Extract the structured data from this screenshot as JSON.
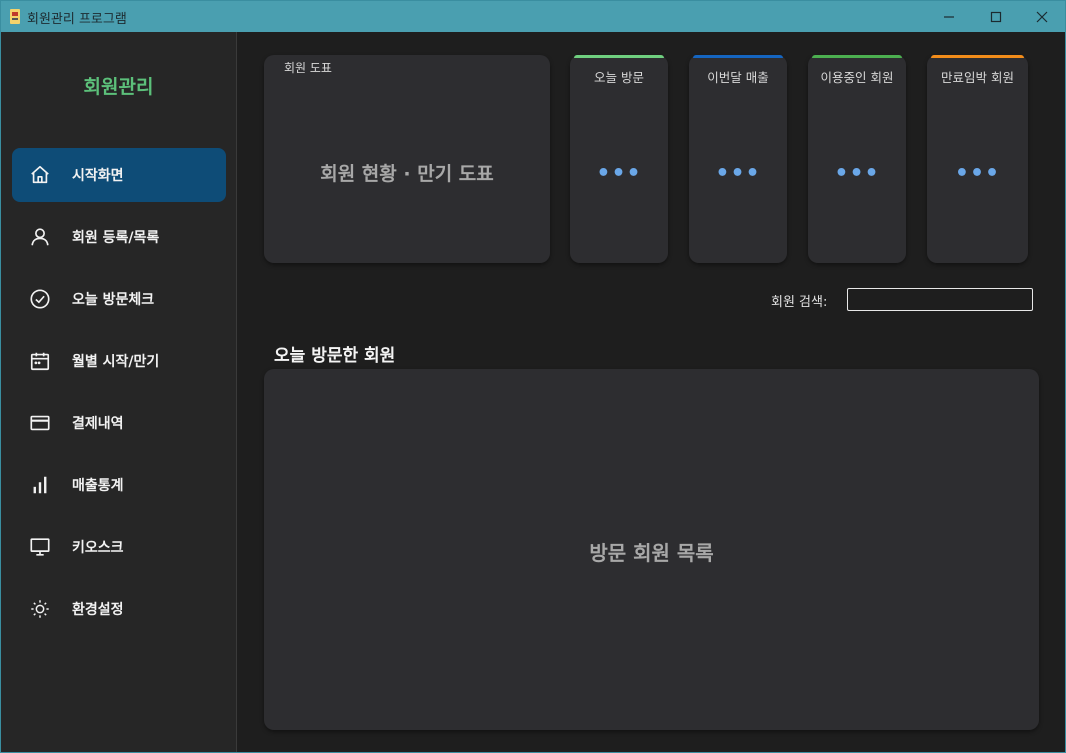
{
  "window": {
    "title": "회원관리 프로그램",
    "controls": {
      "minimize": "minimize-icon",
      "maximize": "maximize-icon",
      "close": "close-icon"
    }
  },
  "sidebar": {
    "brand": "회원관리",
    "items": [
      {
        "label": "시작화면",
        "icon": "home-icon",
        "active": true
      },
      {
        "label": "회원 등록/목록",
        "icon": "user-icon",
        "active": false
      },
      {
        "label": "오늘 방문체크",
        "icon": "check-circle-icon",
        "active": false
      },
      {
        "label": "월별 시작/만기",
        "icon": "calendar-icon",
        "active": false
      },
      {
        "label": "결제내역",
        "icon": "credit-card-icon",
        "active": false
      },
      {
        "label": "매출통계",
        "icon": "bar-chart-icon",
        "active": false
      },
      {
        "label": "키오스크",
        "icon": "monitor-icon",
        "active": false
      },
      {
        "label": "환경설정",
        "icon": "sun-settings-icon",
        "active": false
      }
    ]
  },
  "dashboard": {
    "chart_card": {
      "title": "회원 도표",
      "placeholder": "회원 현황 · 만기 도표"
    },
    "stats": [
      {
        "title": "오늘 방문",
        "value": "•••",
        "accent": "#6fcf7f"
      },
      {
        "title": "이번달 매출",
        "value": "•••",
        "accent": "#1565c0"
      },
      {
        "title": "이용중인 회원",
        "value": "•••",
        "accent": "#4caf50"
      },
      {
        "title": "만료임박 회원",
        "value": "•••",
        "accent": "#f28c1a"
      }
    ],
    "search": {
      "label": "회원 검색:",
      "value": "",
      "placeholder": ""
    },
    "visitors": {
      "title": "오늘 방문한 회원",
      "placeholder": "방문 회원 목록"
    }
  },
  "colors": {
    "titlebar": "#4a9fb0",
    "brand": "#5cc07a",
    "active_nav": "#0e4c77",
    "stat_value": "#6aa7e8"
  }
}
